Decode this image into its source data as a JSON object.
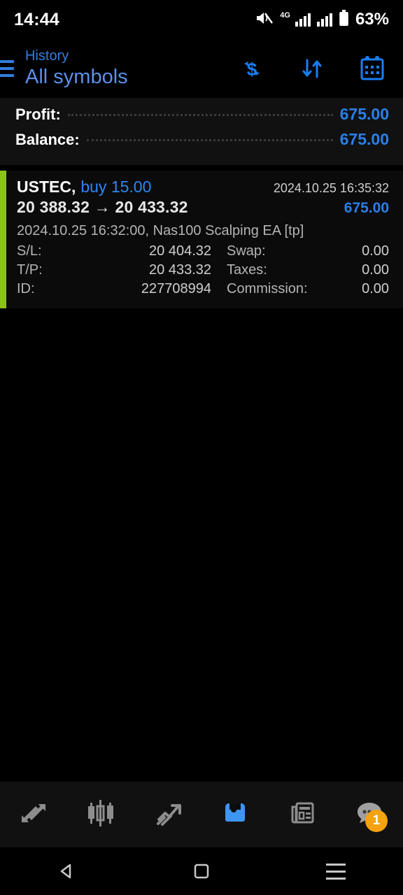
{
  "status_bar": {
    "time": "14:44",
    "battery": "63%",
    "network": "4G",
    "icons": [
      "mute-icon",
      "signal-icon",
      "battery-icon"
    ]
  },
  "header": {
    "menu_icon": "hamburger-menu-icon",
    "subtitle": "History",
    "title": "All symbols",
    "actions": [
      {
        "name": "currency-icon",
        "label": "Currency"
      },
      {
        "name": "sort-icon",
        "label": "Sort"
      },
      {
        "name": "calendar-icon",
        "label": "Period"
      }
    ]
  },
  "summary": {
    "rows": [
      {
        "label": "Profit:",
        "value": "675.00"
      },
      {
        "label": "Balance:",
        "value": "675.00"
      }
    ],
    "value_color": "#2a7fe8"
  },
  "trade": {
    "accent_color": "#8cc21c",
    "symbol": "USTEC,",
    "direction": "buy 15.00",
    "close_time": "2024.10.25 16:35:32",
    "prices": "20 388.32  →  20 433.32",
    "profit": "675.00",
    "meta": "2024.10.25 16:32:00, Nas100 Scalping EA [tp]",
    "details": [
      {
        "label": "S/L:",
        "value": "20 404.32",
        "label2": "Swap:",
        "value2": "0.00"
      },
      {
        "label": "T/P:",
        "value": "20 433.32",
        "label2": "Taxes:",
        "value2": "0.00"
      },
      {
        "label": "ID:",
        "value": "227708994",
        "label2": "Commission:",
        "value2": "0.00"
      }
    ]
  },
  "bottom_nav": {
    "items": [
      {
        "name": "quotes",
        "icon": "quotes-arrows-icon",
        "active": false
      },
      {
        "name": "charts",
        "icon": "candlestick-icon",
        "active": false
      },
      {
        "name": "trade",
        "icon": "trend-arrow-icon",
        "active": false
      },
      {
        "name": "history",
        "icon": "inbox-tray-icon",
        "active": true
      },
      {
        "name": "news",
        "icon": "newspaper-icon",
        "active": false
      },
      {
        "name": "chat",
        "icon": "chat-bubble-icon",
        "active": false,
        "badge": "1"
      }
    ],
    "active_color": "#3d97f2",
    "badge_color": "#f5a211"
  },
  "android_nav": {
    "back": "back-triangle-icon",
    "home": "home-square-icon",
    "recents": "recents-icon"
  }
}
